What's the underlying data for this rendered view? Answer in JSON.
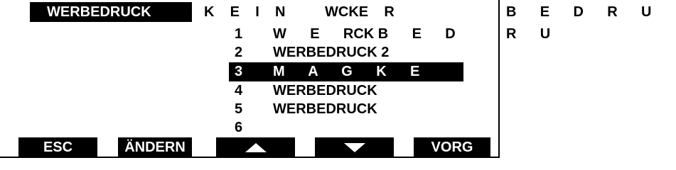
{
  "header": {
    "title": "WERBEDRUCK",
    "scrambled_row1": "K    E    I    N          WCKE    R",
    "side_row1": "B      E      D      R      U"
  },
  "menu": {
    "items": [
      {
        "num": "1",
        "text": "W      E      RCK B      E      D"
      },
      {
        "num": "2",
        "text": "WERBEDRUCK 2"
      },
      {
        "num": "3",
        "text": "M      A      G      K      E"
      },
      {
        "num": "4",
        "text": "WERBEDRUCK"
      },
      {
        "num": "5",
        "text": "WERBEDRUCK"
      },
      {
        "num": "6",
        "text": ""
      }
    ],
    "selected_index": 3,
    "side_row2": "R      U"
  },
  "softkeys": {
    "esc": "ESC",
    "change": "ÄNDERN",
    "up_icon": "arrow-up-icon",
    "down_icon": "arrow-down-icon",
    "next": "VORG"
  }
}
